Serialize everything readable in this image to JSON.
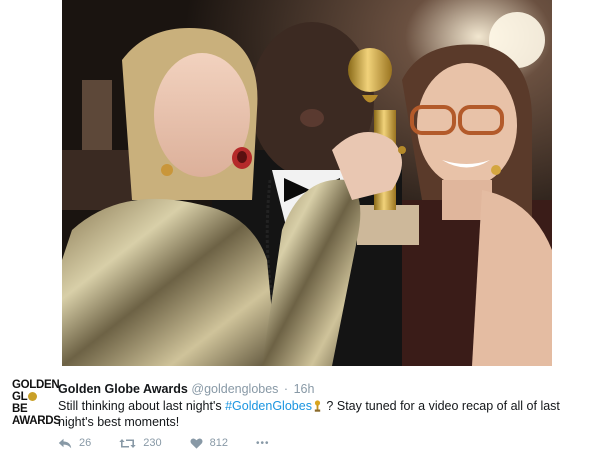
{
  "tweet": {
    "account_name": "Golden Globe Awards",
    "handle": "@goldenglobes",
    "separator": "·",
    "time": "16h",
    "text_before": "Still thinking about last night's ",
    "hashtag": "#GoldenGlobes",
    "text_after": " ? Stay tuned for a video recap of all of last night's best moments!",
    "trophy_emoji": "trophy-icon"
  },
  "avatar": {
    "line1": "GOLDEN",
    "line2_a": "GL",
    "line2_b": "BE",
    "line3": "AWARDS"
  },
  "actions": {
    "replies": "26",
    "retweets": "230",
    "likes": "812",
    "more": "•••"
  },
  "colors": {
    "hashtag": "#1b95e0",
    "meta": "#8899a6",
    "text": "#14171a",
    "globe_gold": "#c9a028"
  },
  "photo": {
    "description_icon": "photo-image"
  }
}
